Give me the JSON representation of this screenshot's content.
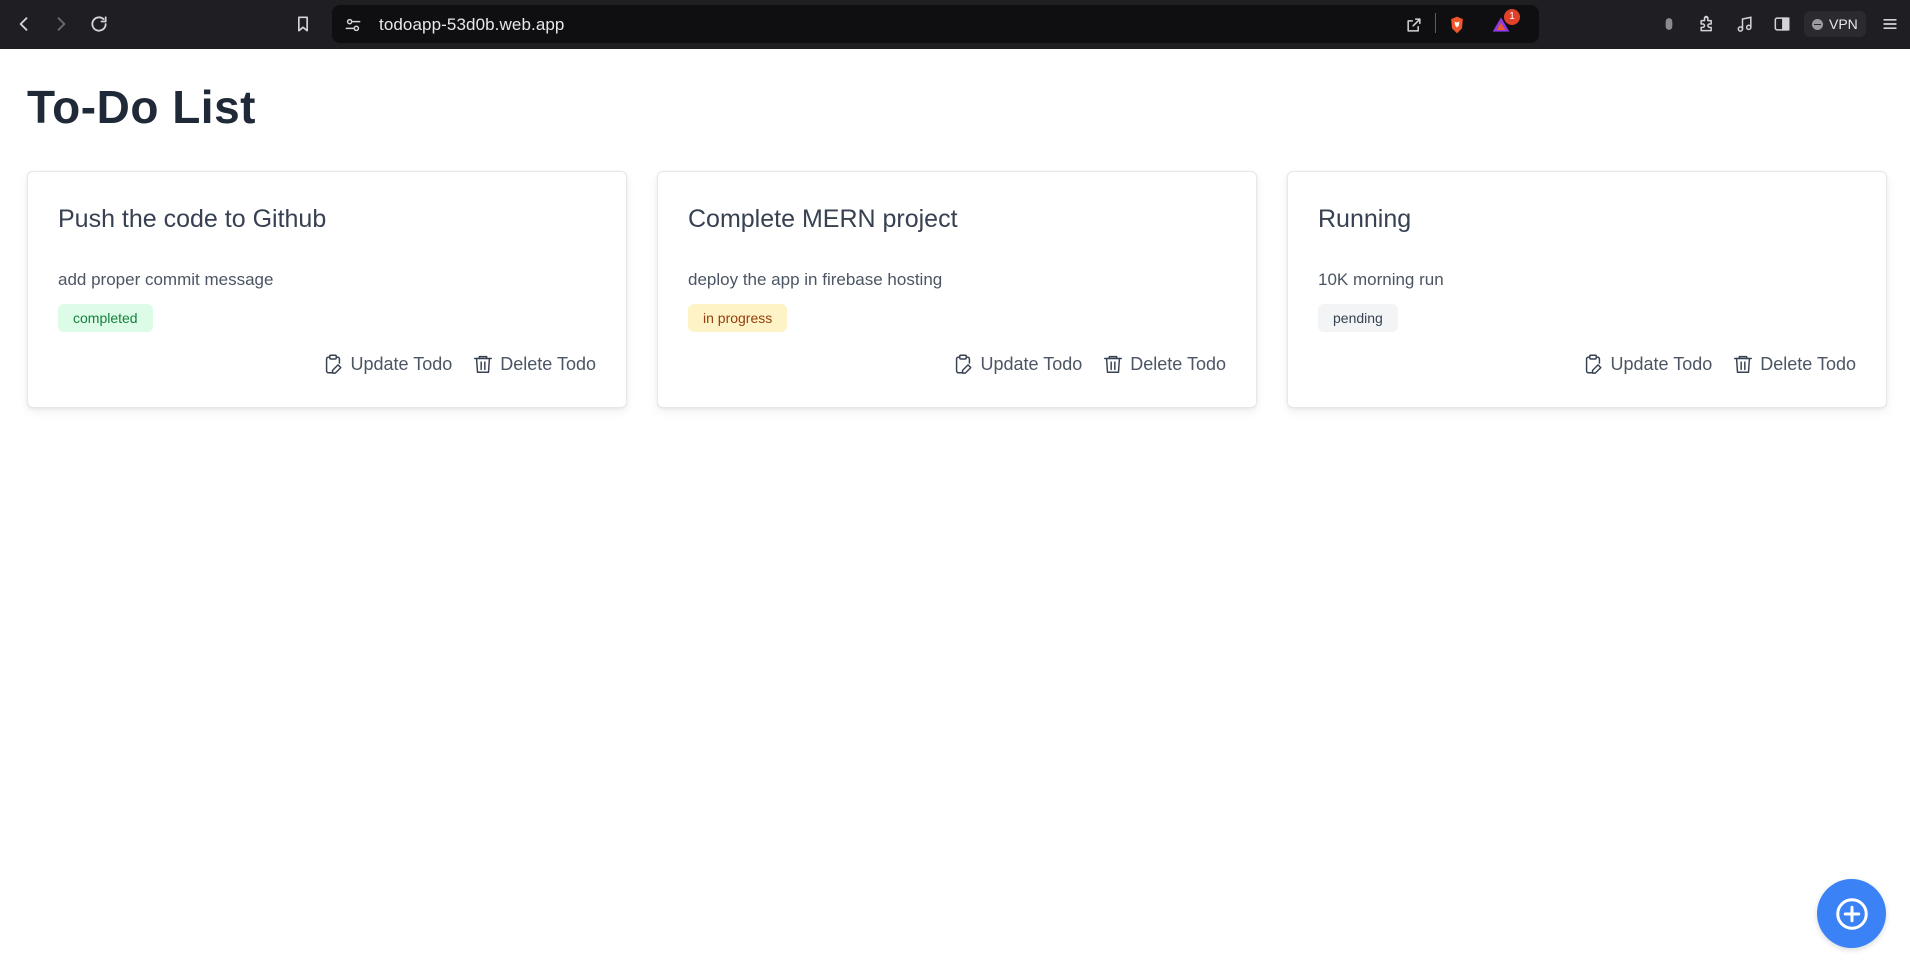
{
  "browser": {
    "url": "todoapp-53d0b.web.app",
    "notification_count": "1",
    "vpn_label": "VPN"
  },
  "page": {
    "title": "To-Do List"
  },
  "todos": [
    {
      "title": "Push the code to Github",
      "description": "add proper commit message",
      "status": "completed"
    },
    {
      "title": "Complete MERN project",
      "description": "deploy the app in firebase hosting",
      "status": "in progress"
    },
    {
      "title": "Running",
      "description": "10K morning run",
      "status": "pending"
    }
  ],
  "actions": {
    "update_label": "Update Todo",
    "delete_label": "Delete Todo"
  },
  "colors": {
    "completed_bg": "#dcfce7",
    "in_progress_bg": "#fef3c7",
    "pending_bg": "#f3f4f6",
    "fab": "#3b82f6"
  },
  "icons": {
    "fab": "circle-plus-icon",
    "update": "clipboard-edit-icon",
    "delete": "trash-icon"
  }
}
